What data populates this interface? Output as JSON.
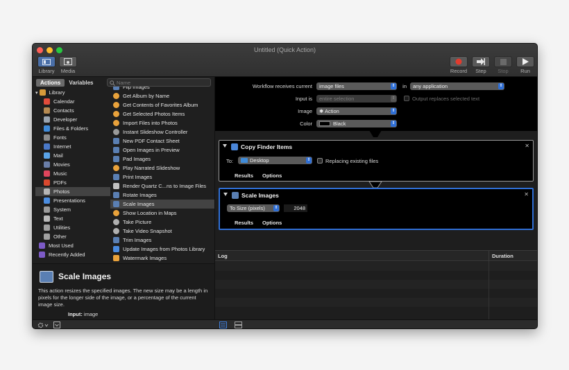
{
  "window": {
    "title": "Untitled (Quick Action)",
    "toolbar_left": [
      {
        "label": "Library"
      },
      {
        "label": "Media"
      }
    ],
    "toolbar_right": [
      {
        "label": "Record"
      },
      {
        "label": "Step"
      },
      {
        "label": "Stop"
      },
      {
        "label": "Run"
      }
    ]
  },
  "library": {
    "tabs": [
      "Actions",
      "Variables"
    ],
    "search_placeholder": "Name",
    "categories": [
      {
        "label": "Library",
        "color": "#d79a3a"
      },
      {
        "label": "Calendar",
        "color": "#e14b3b"
      },
      {
        "label": "Contacts",
        "color": "#b58a52"
      },
      {
        "label": "Developer",
        "color": "#9aa5b1"
      },
      {
        "label": "Files & Folders",
        "color": "#3f8bd9"
      },
      {
        "label": "Fonts",
        "color": "#8c8c8c"
      },
      {
        "label": "Internet",
        "color": "#4a79c8"
      },
      {
        "label": "Mail",
        "color": "#5aa4e8"
      },
      {
        "label": "Movies",
        "color": "#6a7ea8"
      },
      {
        "label": "Music",
        "color": "#e0455c"
      },
      {
        "label": "PDFs",
        "color": "#d9482e"
      },
      {
        "label": "Photos",
        "color": "#b6b6b6"
      },
      {
        "label": "Presentations",
        "color": "#4b8de0"
      },
      {
        "label": "System",
        "color": "#9a9a9a"
      },
      {
        "label": "Text",
        "color": "#b9b9b9"
      },
      {
        "label": "Utilities",
        "color": "#a0a0a0"
      },
      {
        "label": "Other",
        "color": "#a0a0a0"
      },
      {
        "label": "Most Used",
        "color": "#7d5bc7"
      },
      {
        "label": "Recently Added",
        "color": "#7d5bc7"
      }
    ],
    "selected_category": "Photos",
    "actions": [
      {
        "label": "Flip Images"
      },
      {
        "label": "Get Album by Name"
      },
      {
        "label": "Get Contents of Favorites Album"
      },
      {
        "label": "Get Selected Photos Items"
      },
      {
        "label": "Import Files into Photos"
      },
      {
        "label": "Instant Slideshow Controller"
      },
      {
        "label": "New PDF Contact Sheet"
      },
      {
        "label": "Open Images in Preview"
      },
      {
        "label": "Pad Images"
      },
      {
        "label": "Play Narrated Slideshow"
      },
      {
        "label": "Print Images"
      },
      {
        "label": "Render Quartz C...ns to Image Files"
      },
      {
        "label": "Rotate Images"
      },
      {
        "label": "Scale Images"
      },
      {
        "label": "Show Location in Maps"
      },
      {
        "label": "Take Picture"
      },
      {
        "label": "Take Video Snapshot"
      },
      {
        "label": "Trim Images"
      },
      {
        "label": "Update Images from Photos Library"
      },
      {
        "label": "Watermark Images"
      }
    ],
    "selected_action": "Scale Images"
  },
  "description": {
    "title": "Scale Images",
    "text": "This action resizes the specified images. The new size may be a length in pixels for the longer side of the image, or a percentage of the current image size.",
    "input_label": "Input:",
    "input_value": "image"
  },
  "workflow": {
    "receives_label": "Workflow receives current",
    "receives_value": "image files",
    "in_label": "in",
    "in_value": "any application",
    "input_is_label": "Input is",
    "input_is_value": "entire selection",
    "output_replaces_label": "Output replaces selected text",
    "image_label": "Image",
    "image_value": "Action",
    "color_label": "Color",
    "color_value": "Black"
  },
  "cards": [
    {
      "title": "Copy Finder Items",
      "to_label": "To:",
      "to_value": "Desktop",
      "replacing_label": "Replacing existing files",
      "tab_results": "Results",
      "tab_options": "Options"
    },
    {
      "title": "Scale Images",
      "mode_value": "To Size (pixels)",
      "size_value": "2048",
      "tab_results": "Results",
      "tab_options": "Options"
    }
  ],
  "log": {
    "col_log": "Log",
    "col_duration": "Duration"
  }
}
